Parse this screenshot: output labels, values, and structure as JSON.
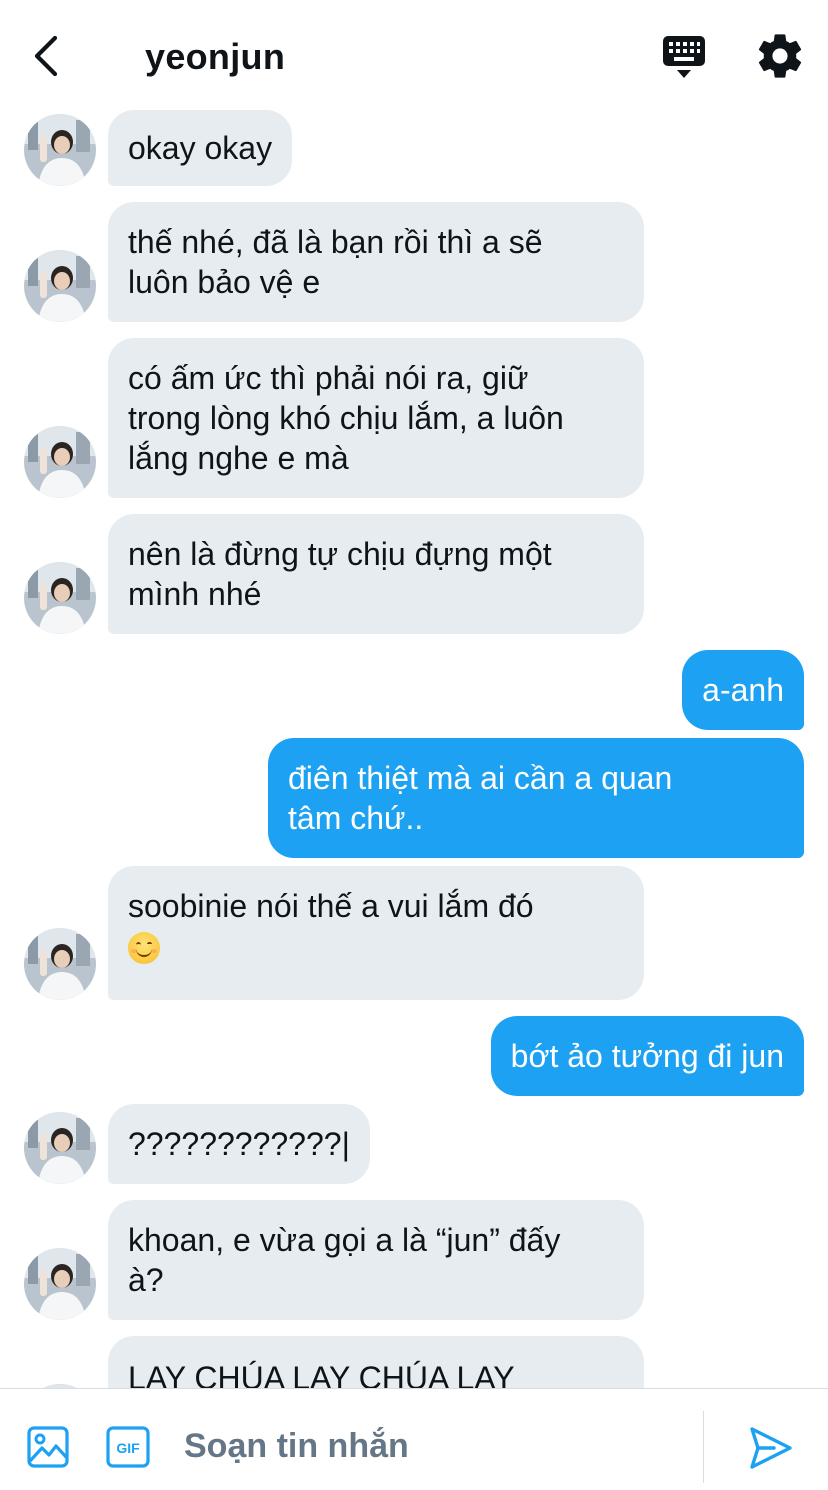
{
  "header": {
    "title": "yeonjun"
  },
  "messages": [
    {
      "side": "in",
      "lines": [
        "okay okay"
      ]
    },
    {
      "side": "in",
      "lines": [
        "thế nhé, đã là bạn rồi thì a sẽ",
        "luôn bảo vệ e"
      ]
    },
    {
      "side": "in",
      "lines": [
        "có ấm ức thì phải nói ra, giữ",
        "trong lòng khó chịu lắm, a luôn",
        "lắng nghe e mà"
      ]
    },
    {
      "side": "in",
      "lines": [
        "nên là đừng tự chịu đựng một",
        "mình nhé"
      ]
    },
    {
      "side": "out",
      "lines": [
        "a-anh"
      ]
    },
    {
      "side": "out",
      "lines": [
        "điên thiệt mà ai cần a quan",
        "tâm chứ.."
      ]
    },
    {
      "side": "in",
      "lines": [
        "soobinie nói thế a vui lắm đó"
      ],
      "emoji": "smiling-face-emoji"
    },
    {
      "side": "out",
      "lines": [
        "bớt ảo tưởng đi jun"
      ]
    },
    {
      "side": "in",
      "lines": [
        "????????????|"
      ]
    },
    {
      "side": "in",
      "lines": [
        "khoan, e vừa gọi a là “jun” đấy",
        "à?"
      ]
    },
    {
      "side": "in",
      "lines": [
        "LAY CHÚA LAY CHÚA LAY"
      ]
    }
  ],
  "composer": {
    "placeholder": "Soạn tin nhắn",
    "value": ""
  },
  "colors": {
    "accent": "#1da1f2",
    "incoming_bubble": "#e6ecf0",
    "text": "#0f1419",
    "muted": "#657786"
  },
  "icons": [
    "back-arrow-icon",
    "keyboard-icon",
    "gear-icon",
    "image-icon",
    "gif-icon",
    "send-icon"
  ]
}
